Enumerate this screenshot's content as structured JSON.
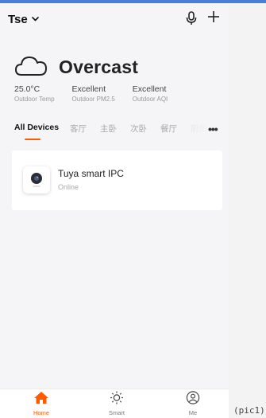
{
  "header": {
    "home_name": "Tse"
  },
  "weather": {
    "condition": "Overcast"
  },
  "metrics": [
    {
      "value": "25.0°C",
      "label": "Outdoor Temp"
    },
    {
      "value": "Excellent",
      "label": "Outdoor PM2.5"
    },
    {
      "value": "Excellent",
      "label": "Outdoor AQI"
    }
  ],
  "tabs": {
    "active": "All Devices",
    "rooms": [
      "客厅",
      "主卧",
      "次卧",
      "餐厅",
      "厨房"
    ],
    "more": "•••"
  },
  "device": {
    "name": "Tuya smart IPC",
    "status": "Online"
  },
  "bottom_nav": [
    {
      "label": "Home"
    },
    {
      "label": "Smart"
    },
    {
      "label": "Me"
    }
  ],
  "caption": "(pic1)",
  "colors": {
    "accent": "#ff5a00",
    "top_line": "#4a7fd8"
  }
}
